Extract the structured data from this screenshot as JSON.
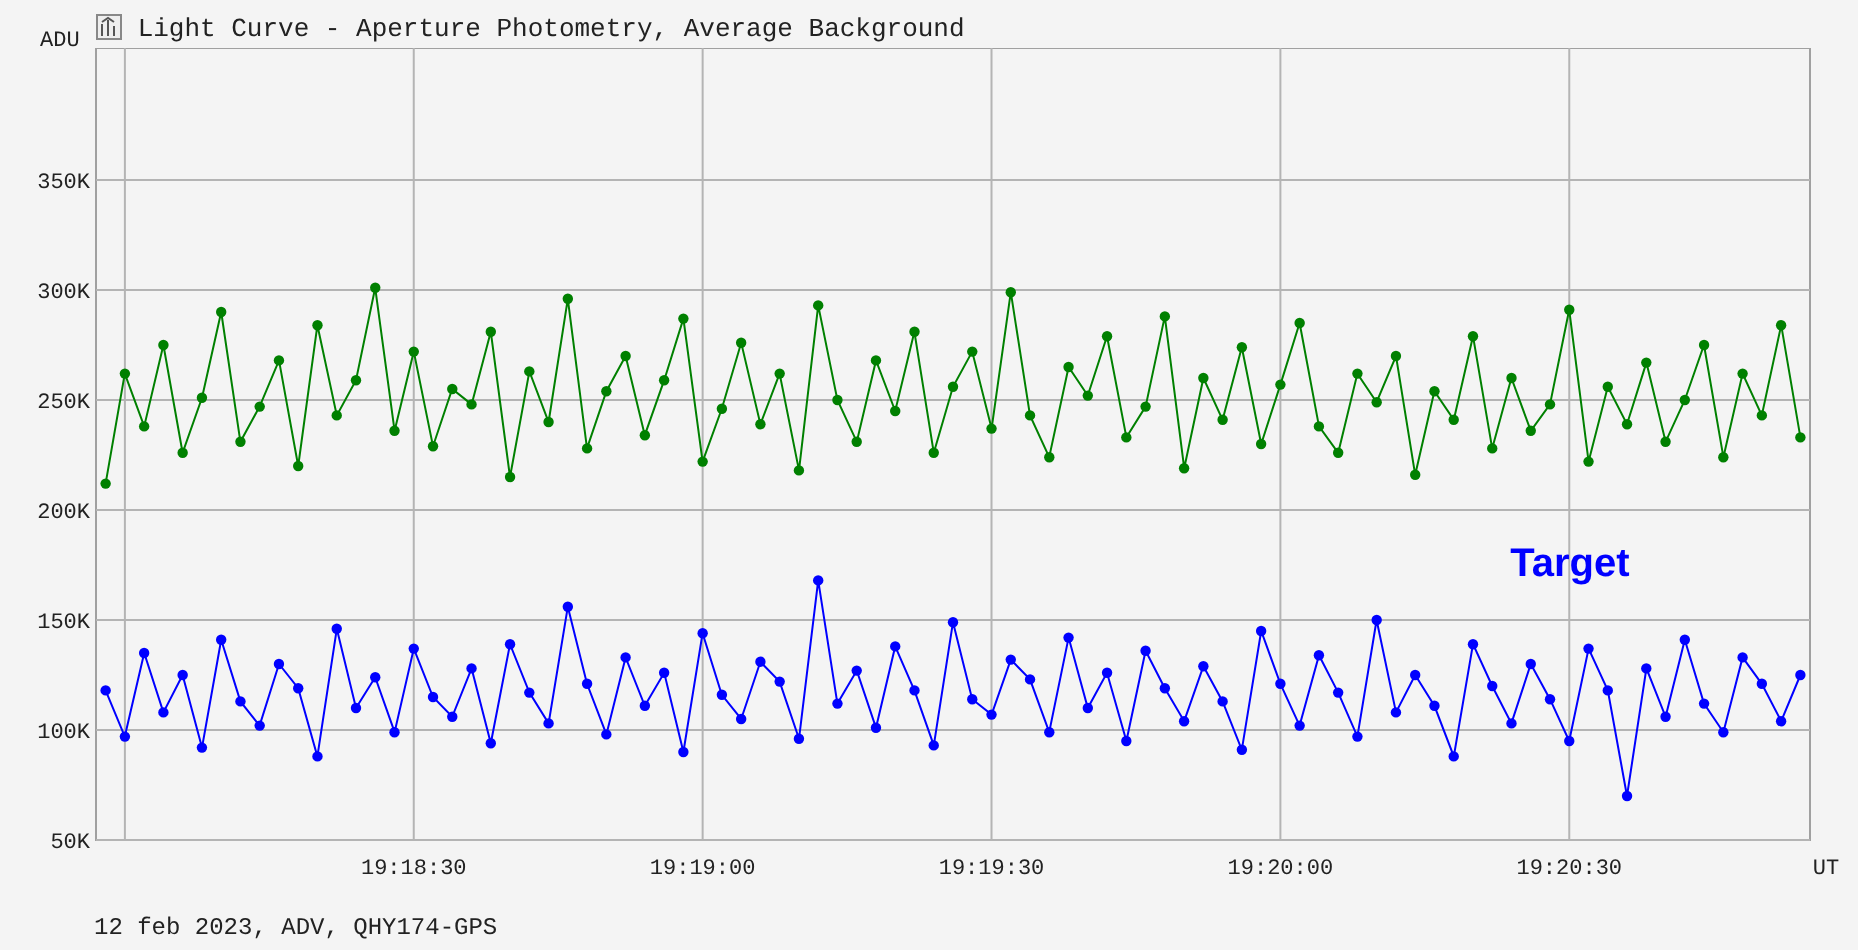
{
  "window": {
    "title": "Light Curve - Aperture Photometry, Average Background"
  },
  "chart": {
    "chart_data": {
      "type": "line",
      "ylabel": "ADU",
      "xlabel": "UT",
      "xlim": [
        69477,
        69655
      ],
      "ylim": [
        50,
        410
      ],
      "grid": true,
      "xticks": [
        {
          "value": 69510,
          "label": "19:18:30"
        },
        {
          "value": 69540,
          "label": "19:19:00"
        },
        {
          "value": 69570,
          "label": "19:19:30"
        },
        {
          "value": 69600,
          "label": "19:20:00"
        },
        {
          "value": 69630,
          "label": "19:20:30"
        }
      ],
      "yticks": [
        {
          "value": 50,
          "label": "50K"
        },
        {
          "value": 100,
          "label": "100K"
        },
        {
          "value": 150,
          "label": "150K"
        },
        {
          "value": 200,
          "label": "200K"
        },
        {
          "value": 250,
          "label": "250K"
        },
        {
          "value": 300,
          "label": "300K"
        },
        {
          "value": 350,
          "label": "350K"
        }
      ],
      "x": [
        69478,
        69480,
        69482,
        69484,
        69486,
        69488,
        69490,
        69492,
        69494,
        69496,
        69498,
        69500,
        69502,
        69504,
        69506,
        69508,
        69510,
        69512,
        69514,
        69516,
        69518,
        69520,
        69522,
        69524,
        69526,
        69528,
        69530,
        69532,
        69534,
        69536,
        69538,
        69540,
        69542,
        69544,
        69546,
        69548,
        69550,
        69552,
        69554,
        69556,
        69558,
        69560,
        69562,
        69564,
        69566,
        69568,
        69570,
        69572,
        69574,
        69576,
        69578,
        69580,
        69582,
        69584,
        69586,
        69588,
        69590,
        69592,
        69594,
        69596,
        69598,
        69600,
        69602,
        69604,
        69606,
        69608,
        69610,
        69612,
        69614,
        69616,
        69618,
        69620,
        69622,
        69624,
        69626,
        69628,
        69630,
        69632,
        69634,
        69636,
        69638,
        69640,
        69642,
        69644,
        69646,
        69648,
        69650,
        69652,
        69654
      ],
      "series": [
        {
          "color": "#008000",
          "marker": "circle",
          "values": [
            212,
            262,
            238,
            275,
            226,
            251,
            290,
            231,
            247,
            268,
            220,
            284,
            243,
            259,
            301,
            236,
            272,
            229,
            255,
            248,
            281,
            215,
            263,
            240,
            296,
            228,
            254,
            270,
            234,
            259,
            287,
            222,
            246,
            276,
            239,
            262,
            218,
            293,
            250,
            231,
            268,
            245,
            281,
            226,
            256,
            272,
            237,
            299,
            243,
            224,
            265,
            252,
            279,
            233,
            247,
            288,
            219,
            260,
            241,
            274,
            230,
            257,
            285,
            238,
            226,
            262,
            249,
            270,
            216,
            254,
            241,
            279,
            228,
            260,
            236,
            248,
            291,
            222,
            256,
            239,
            267,
            231,
            250,
            275,
            224,
            262,
            243,
            284,
            233
          ]
        },
        {
          "name": "Target",
          "color": "#0000ff",
          "marker": "circle",
          "values": [
            118,
            97,
            135,
            108,
            125,
            92,
            141,
            113,
            102,
            130,
            119,
            88,
            146,
            110,
            124,
            99,
            137,
            115,
            106,
            128,
            94,
            139,
            117,
            103,
            156,
            121,
            98,
            133,
            111,
            126,
            90,
            144,
            116,
            105,
            131,
            122,
            96,
            168,
            112,
            127,
            101,
            138,
            118,
            93,
            149,
            114,
            107,
            132,
            123,
            99,
            142,
            110,
            126,
            95,
            136,
            119,
            104,
            129,
            113,
            91,
            145,
            121,
            102,
            134,
            117,
            97,
            150,
            108,
            125,
            111,
            88,
            139,
            120,
            103,
            130,
            114,
            95,
            137,
            118,
            70,
            128,
            106,
            141,
            112,
            99,
            133,
            121,
            104,
            125
          ]
        }
      ]
    }
  },
  "status_bar": "12 feb 2023, ADV, QHY174-GPS"
}
